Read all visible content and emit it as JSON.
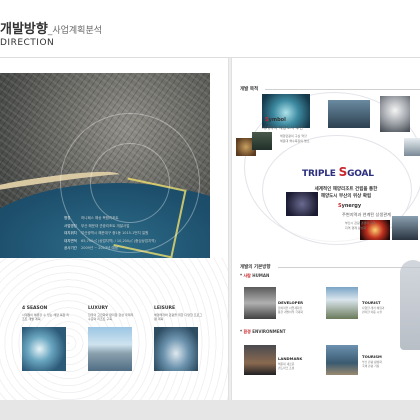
{
  "header": {
    "title_ko": "개발방향",
    "title_sub": "_사업계획분석",
    "title_en": "DIRECTION"
  },
  "site_info": [
    {
      "k": "명칭",
      "v": "하니페스 해상 복합리조트"
    },
    {
      "k": "사업명칭",
      "v": "부산 해운대 관광리조트 개발사업"
    },
    {
      "k": "대지위치",
      "v": "부산광역시 해운대구 중1동 1015-1번지 일원"
    },
    {
      "k": "대지면적",
      "v": "65,790㎡ (상업지역) / 10,200㎡ (중심상업지역)"
    },
    {
      "k": "공사기간",
      "v": "2009년 ~ 2013년 예정"
    }
  ],
  "themes": [
    {
      "title": "4 SEASON",
      "text": "사계절이 체류할 수 있는 해양 복합 리조트 개발 계획"
    },
    {
      "title": "LUXURY",
      "text": "한국의 고급화와 편리함 향상 국제적 수준의 리조트 구축"
    },
    {
      "title": "LEISURE",
      "text": "해양레저와 관광을 위한 다양한 프로그램 계획"
    }
  ],
  "right": {
    "goal_heading": "개발 목적",
    "symbol": {
      "first": "S",
      "rest": "ymbol",
      "sub": "세계속의 해양도시 부산",
      "small": [
        "해양관광의 구심 역할",
        "해운대 해수욕장의 명소"
      ]
    },
    "triple": {
      "before": "TRIPLE",
      "s": "S",
      "after": "GOAL"
    },
    "goal_sub": [
      "세계적인 해양리조트 건립을 통한",
      "해양도시 부산의 위상 확립"
    ],
    "synergy": {
      "first": "S",
      "rest": "ynergy",
      "sub": "주변지역과 연계된 상생관계",
      "small": [
        "부산시 관광 경쟁력 강화",
        "지역 경제 활성화"
      ]
    },
    "basic_heading": "개발의 기본방향",
    "human": {
      "label": "사람",
      "en": "HUMAN"
    },
    "environment": {
      "label": "환경",
      "en": "ENVIRONMENT"
    },
    "developer": {
      "title": "DEVELOPER",
      "text": [
        "합리적인 사업계획을",
        "통한 개발이익 극대화"
      ]
    },
    "tourist": {
      "title": "TOURIST",
      "text": [
        "다양한 레저 체험과",
        "편리한 이용 시설"
      ]
    },
    "landmark": {
      "title": "LANDMARK",
      "text": [
        "해운대 새로운",
        "랜드마크 조성"
      ]
    },
    "tourism": {
      "title": "TOURISM",
      "text": [
        "부산 관광 활성화",
        "국제 관광 거점"
      ]
    }
  }
}
